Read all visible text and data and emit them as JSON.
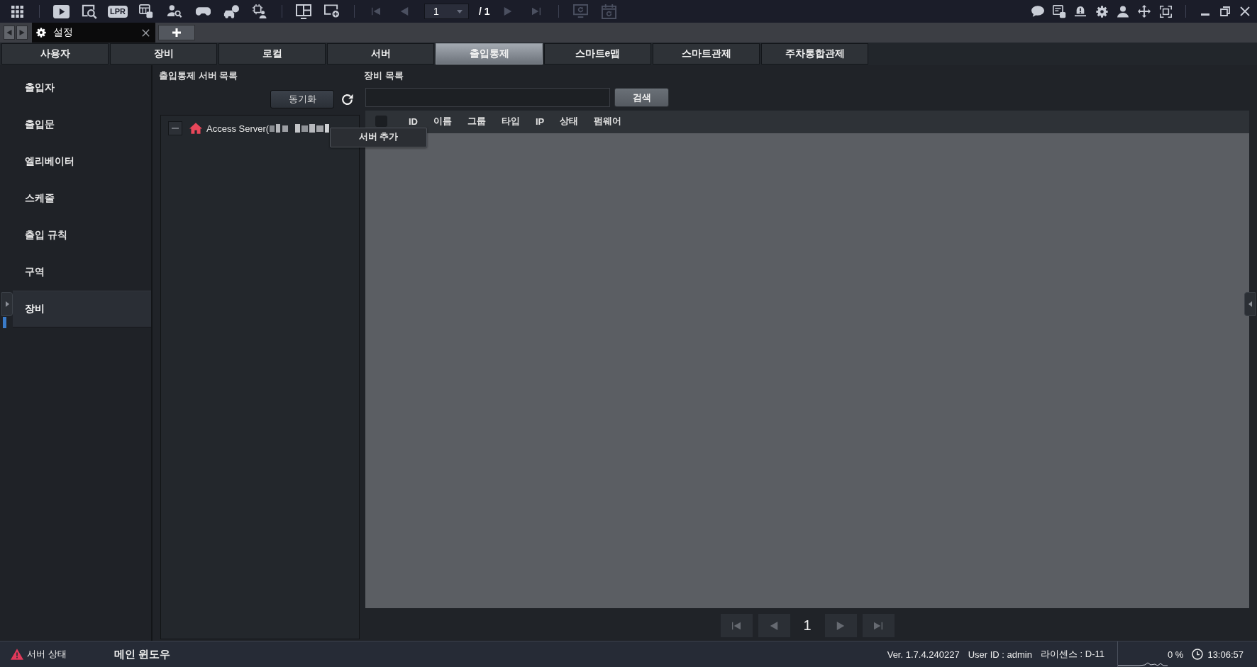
{
  "toolbar": {
    "lpr_label": "LPR",
    "page": "1",
    "page_total": "/ 1"
  },
  "window_tabs": [
    {
      "label": "설정",
      "selected": true
    }
  ],
  "category_tabs": [
    {
      "label": "사용자",
      "selected": false
    },
    {
      "label": "장비",
      "selected": false
    },
    {
      "label": "로컬",
      "selected": false
    },
    {
      "label": "서버",
      "selected": false
    },
    {
      "label": "출입통제",
      "selected": true
    },
    {
      "label": "스마트e맵",
      "selected": false
    },
    {
      "label": "스마트관제",
      "selected": false
    },
    {
      "label": "주차통합관제",
      "selected": false
    }
  ],
  "sidebar": {
    "items": [
      {
        "label": "출입자",
        "selected": false
      },
      {
        "label": "출입문",
        "selected": false
      },
      {
        "label": "엘리베이터",
        "selected": false
      },
      {
        "label": "스케줄",
        "selected": false
      },
      {
        "label": "출입 규칙",
        "selected": false
      },
      {
        "label": "구역",
        "selected": false
      },
      {
        "label": "장비",
        "selected": true
      }
    ]
  },
  "server_panel": {
    "title": "출입통제 서버 목록",
    "sync_button": "동기화",
    "tree": [
      {
        "label": "Access Server(",
        "expanded": true
      }
    ],
    "context_menu": [
      "서버 추가"
    ]
  },
  "device_panel": {
    "title": "장비 목록",
    "search_button": "검색",
    "table": {
      "header_checked": false,
      "columns": [
        "ID",
        "이름",
        "그룹",
        "타입",
        "IP",
        "상태",
        "펌웨어"
      ]
    },
    "pagination": {
      "page": "1"
    }
  },
  "status_bar": {
    "server_status": {
      "label": "서버 상태",
      "warning": true
    },
    "window_name": "메인 윈도우",
    "version": "Ver. 1.7.4.240227",
    "user_id": "User ID : admin",
    "license": "라이센스 : D-11",
    "cpu": "0 %",
    "time": "13:06:57"
  }
}
